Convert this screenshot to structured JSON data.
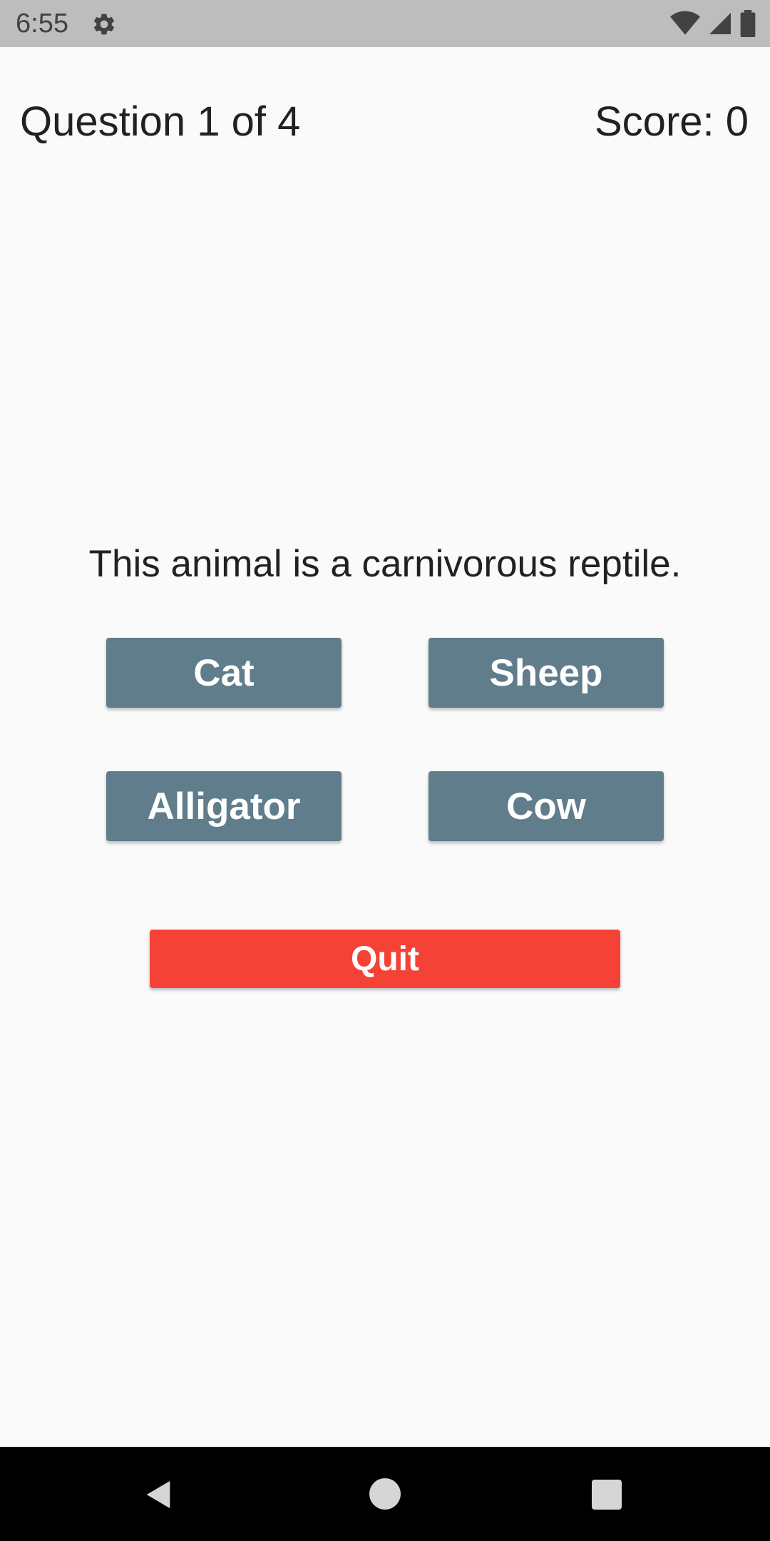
{
  "status_bar": {
    "time": "6:55",
    "icons": [
      "gear-icon",
      "wifi-icon",
      "signal-icon",
      "battery-icon"
    ],
    "background": "#bdbdbd"
  },
  "header": {
    "progress": "Question 1 of 4",
    "score": "Score: 0"
  },
  "question": {
    "text": "This animal is a carnivorous reptile."
  },
  "answers": [
    {
      "label": "Cat"
    },
    {
      "label": "Sheep"
    },
    {
      "label": "Alligator"
    },
    {
      "label": "Cow"
    }
  ],
  "quit": {
    "label": "Quit"
  },
  "colors": {
    "answer_button": "#607d8b",
    "quit_button": "#f44336",
    "text": "#212121",
    "background": "#fafafa"
  },
  "nav_bar": {
    "icons": [
      "back-icon",
      "home-icon",
      "recents-icon"
    ]
  }
}
